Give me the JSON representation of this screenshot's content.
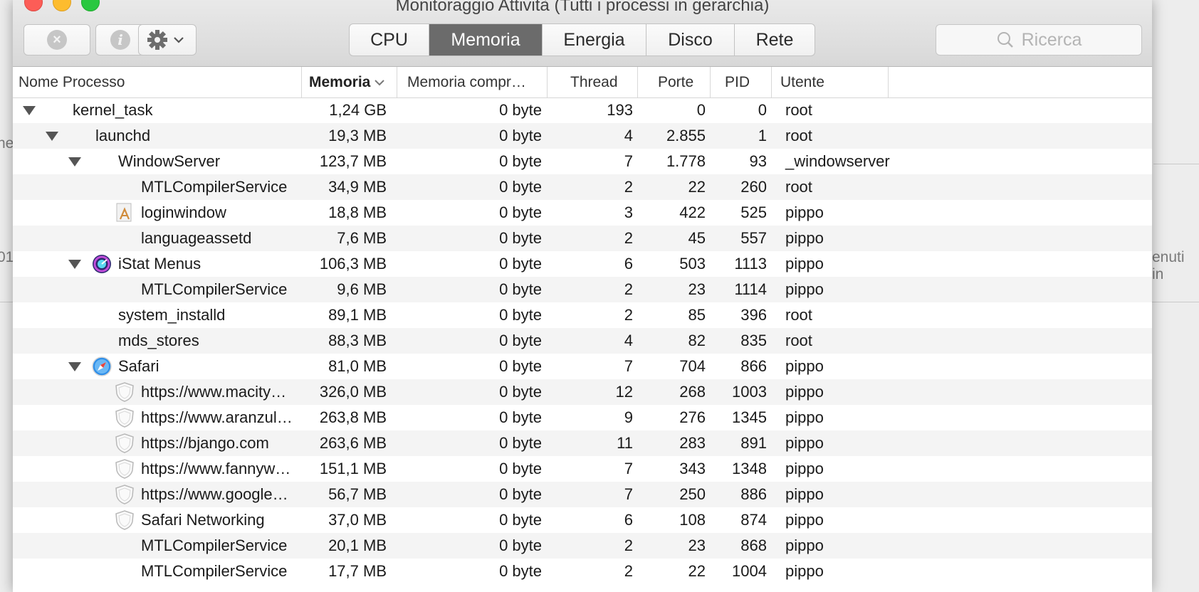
{
  "window": {
    "title": "Monitoraggio Attività (Tutti i processi in gerarchia)"
  },
  "background": {
    "left_fragment_1": "ne",
    "left_fragment_2": "01",
    "right_fragment": "enuti in"
  },
  "toolbar": {
    "stop_icon": "x-circle-icon",
    "info_icon": "info-icon",
    "gear_icon": "gear-icon",
    "tabs": [
      "CPU",
      "Memoria",
      "Energia",
      "Disco",
      "Rete"
    ],
    "active_tab": "Memoria",
    "search_placeholder": "Ricerca"
  },
  "columns": {
    "name": "Nome Processo",
    "memory": "Memoria",
    "compressed": "Memoria compr…",
    "threads": "Thread",
    "ports": "Porte",
    "pid": "PID",
    "user": "Utente"
  },
  "processes": [
    {
      "name": "kernel_task",
      "memory": "1,24 GB",
      "compressed": "0 byte",
      "threads": "193",
      "ports": "0",
      "pid": "0",
      "user": "root",
      "depth": 0,
      "expand": true,
      "icon": ""
    },
    {
      "name": "launchd",
      "memory": "19,3 MB",
      "compressed": "0 byte",
      "threads": "4",
      "ports": "2.855",
      "pid": "1",
      "user": "root",
      "depth": 1,
      "expand": true,
      "icon": ""
    },
    {
      "name": "WindowServer",
      "memory": "123,7 MB",
      "compressed": "0 byte",
      "threads": "7",
      "ports": "1.778",
      "pid": "93",
      "user": "_windowserver",
      "depth": 2,
      "expand": true,
      "icon": ""
    },
    {
      "name": "MTLCompilerService",
      "memory": "34,9 MB",
      "compressed": "0 byte",
      "threads": "2",
      "ports": "22",
      "pid": "260",
      "user": "root",
      "depth": 3,
      "expand": false,
      "icon": ""
    },
    {
      "name": "loginwindow",
      "memory": "18,8 MB",
      "compressed": "0 byte",
      "threads": "3",
      "ports": "422",
      "pid": "525",
      "user": "pippo",
      "depth": 3,
      "expand": false,
      "icon": "app-document-icon"
    },
    {
      "name": "languageassetd",
      "memory": "7,6 MB",
      "compressed": "0 byte",
      "threads": "2",
      "ports": "45",
      "pid": "557",
      "user": "pippo",
      "depth": 3,
      "expand": false,
      "icon": ""
    },
    {
      "name": "iStat Menus",
      "memory": "106,3 MB",
      "compressed": "0 byte",
      "threads": "6",
      "ports": "503",
      "pid": "1113",
      "user": "pippo",
      "depth": 2,
      "expand": true,
      "icon": "istat-gauge-icon"
    },
    {
      "name": "MTLCompilerService",
      "memory": "9,6 MB",
      "compressed": "0 byte",
      "threads": "2",
      "ports": "23",
      "pid": "1114",
      "user": "pippo",
      "depth": 3,
      "expand": false,
      "icon": ""
    },
    {
      "name": "system_installd",
      "memory": "89,1 MB",
      "compressed": "0 byte",
      "threads": "2",
      "ports": "85",
      "pid": "396",
      "user": "root",
      "depth": 2,
      "expand": false,
      "icon": ""
    },
    {
      "name": "mds_stores",
      "memory": "88,3 MB",
      "compressed": "0 byte",
      "threads": "4",
      "ports": "82",
      "pid": "835",
      "user": "root",
      "depth": 2,
      "expand": false,
      "icon": ""
    },
    {
      "name": "Safari",
      "memory": "81,0 MB",
      "compressed": "0 byte",
      "threads": "7",
      "ports": "704",
      "pid": "866",
      "user": "pippo",
      "depth": 2,
      "expand": true,
      "icon": "safari-compass-icon"
    },
    {
      "name": "https://www.macity…",
      "memory": "326,0 MB",
      "compressed": "0 byte",
      "threads": "12",
      "ports": "268",
      "pid": "1003",
      "user": "pippo",
      "depth": 3,
      "expand": false,
      "icon": "shield-icon"
    },
    {
      "name": "https://www.aranzul…",
      "memory": "263,8 MB",
      "compressed": "0 byte",
      "threads": "9",
      "ports": "276",
      "pid": "1345",
      "user": "pippo",
      "depth": 3,
      "expand": false,
      "icon": "shield-icon"
    },
    {
      "name": "https://bjango.com",
      "memory": "263,6 MB",
      "compressed": "0 byte",
      "threads": "11",
      "ports": "283",
      "pid": "891",
      "user": "pippo",
      "depth": 3,
      "expand": false,
      "icon": "shield-icon"
    },
    {
      "name": "https://www.fannyw…",
      "memory": "151,1 MB",
      "compressed": "0 byte",
      "threads": "7",
      "ports": "343",
      "pid": "1348",
      "user": "pippo",
      "depth": 3,
      "expand": false,
      "icon": "shield-icon"
    },
    {
      "name": "https://www.google…",
      "memory": "56,7 MB",
      "compressed": "0 byte",
      "threads": "7",
      "ports": "250",
      "pid": "886",
      "user": "pippo",
      "depth": 3,
      "expand": false,
      "icon": "shield-icon"
    },
    {
      "name": "Safari Networking",
      "memory": "37,0 MB",
      "compressed": "0 byte",
      "threads": "6",
      "ports": "108",
      "pid": "874",
      "user": "pippo",
      "depth": 3,
      "expand": false,
      "icon": "shield-icon"
    },
    {
      "name": "MTLCompilerService",
      "memory": "20,1 MB",
      "compressed": "0 byte",
      "threads": "2",
      "ports": "23",
      "pid": "868",
      "user": "pippo",
      "depth": 3,
      "expand": false,
      "icon": ""
    },
    {
      "name": "MTLCompilerService",
      "memory": "17,7 MB",
      "compressed": "0 byte",
      "threads": "2",
      "ports": "22",
      "pid": "1004",
      "user": "pippo",
      "depth": 3,
      "expand": false,
      "icon": ""
    }
  ]
}
